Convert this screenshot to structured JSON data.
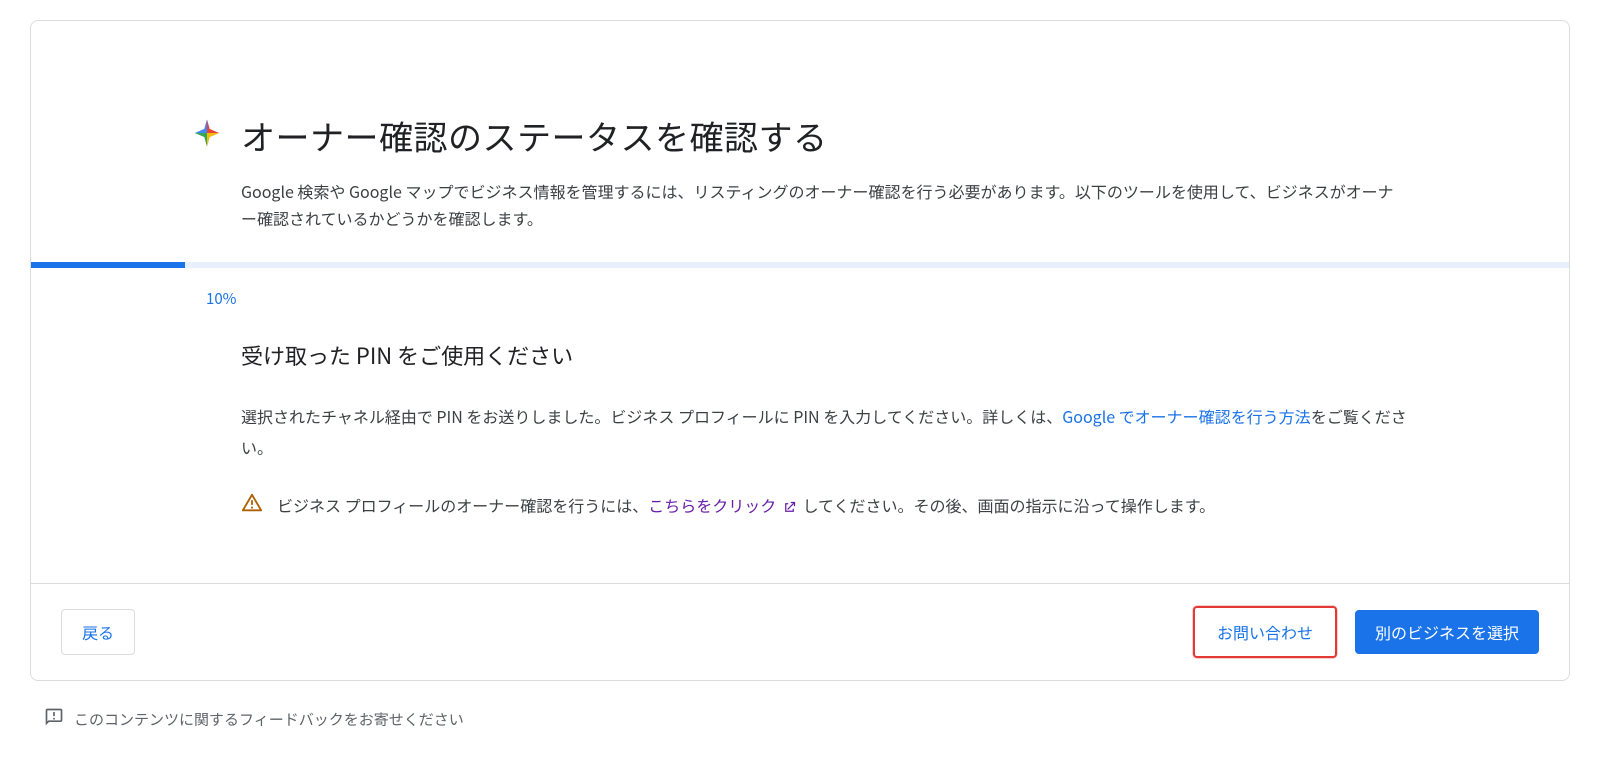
{
  "header": {
    "title": "オーナー確認のステータスを確認する",
    "subtitle": "Google 検索や Google マップでビジネス情報を管理するには、リスティングのオーナー確認を行う必要があります。以下のツールを使用して、ビジネスがオーナー確認されているかどうかを確認します。"
  },
  "progress": {
    "label": "10%",
    "percent": 10
  },
  "content": {
    "title": "受け取った PIN をご使用ください",
    "body_pre": "選択されたチャネル経由で PIN をお送りしました。ビジネス プロフィールに PIN を入力してください。詳しくは、",
    "body_link": "Google でオーナー確認を行う方法",
    "body_post": "をご覧ください。",
    "alert_pre": "ビジネス プロフィールのオーナー確認を行うには、",
    "alert_link": "こちらをクリック",
    "alert_post": "してください。その後、画面の指示に沿って操作します。"
  },
  "footer": {
    "back": "戻る",
    "contact": "お問い合わせ",
    "select_other": "別のビジネスを選択"
  },
  "feedback": {
    "text": "このコンテンツに関するフィードバックをお寄せください"
  }
}
